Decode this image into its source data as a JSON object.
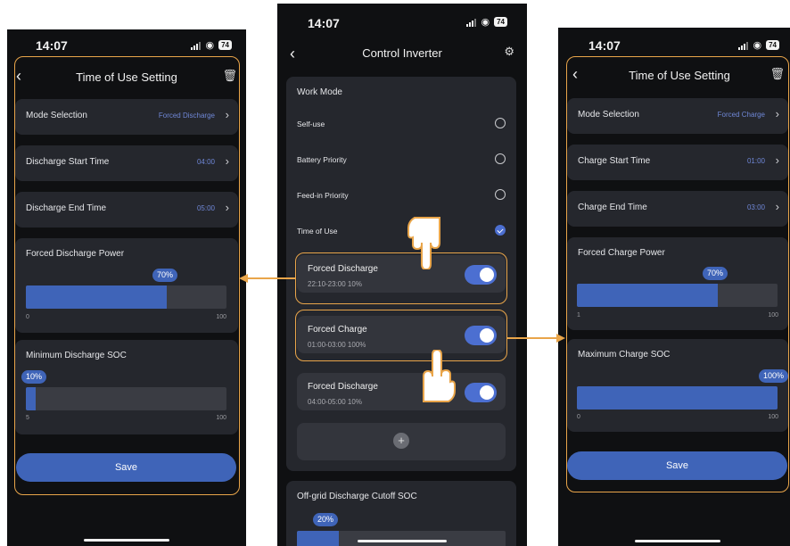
{
  "left_phone": {
    "status_time": "14:07",
    "battery": "74",
    "title": "Time of Use Setting",
    "rows": [
      {
        "label": "Mode Selection",
        "value": "Forced Discharge"
      },
      {
        "label": "Discharge Start Time",
        "value": "04:00"
      },
      {
        "label": "Discharge End Time",
        "value": "05:00"
      }
    ],
    "power": {
      "label": "Forced Discharge Power",
      "bubble": "70%",
      "value": 0.7,
      "min": "0",
      "max": "100"
    },
    "soc": {
      "label": "Minimum Discharge SOC",
      "bubble": "10%",
      "value": 0.05,
      "min": "5",
      "max": "100"
    },
    "save_label": "Save"
  },
  "center_phone": {
    "status_time": "14:07",
    "battery": "74",
    "title": "Control Inverter",
    "work_mode_title": "Work Mode",
    "modes": [
      {
        "label": "Self-use",
        "selected": false
      },
      {
        "label": "Battery Priority",
        "selected": false
      },
      {
        "label": "Feed-in Priority",
        "selected": false
      },
      {
        "label": "Time of Use",
        "selected": true
      }
    ],
    "schedules": [
      {
        "title": "Forced Discharge",
        "sub": "22:10-23:00  10%",
        "on": true
      },
      {
        "title": "Forced Charge",
        "sub": "01:00-03:00  100%",
        "on": true
      },
      {
        "title": "Forced Discharge",
        "sub": "04:00-05:00  10%",
        "on": true
      }
    ],
    "offgrid": {
      "label": "Off-grid Discharge Cutoff SOC",
      "bubble": "20%",
      "value": 0.2
    }
  },
  "right_phone": {
    "status_time": "14:07",
    "battery": "74",
    "title": "Time of Use Setting",
    "rows": [
      {
        "label": "Mode Selection",
        "value": "Forced Charge"
      },
      {
        "label": "Charge Start Time",
        "value": "01:00"
      },
      {
        "label": "Charge End Time",
        "value": "03:00"
      }
    ],
    "power": {
      "label": "Forced Charge Power",
      "bubble": "70%",
      "value": 0.7,
      "min": "1",
      "max": "100"
    },
    "soc": {
      "label": "Maximum Charge SOC",
      "bubble": "100%",
      "value": 1.0,
      "min": "0",
      "max": "100"
    },
    "save_label": "Save"
  },
  "colors": {
    "accent": "#3f64b8",
    "highlight": "#e9a54a",
    "card": "#25272d",
    "bg": "#0f1012"
  },
  "icons": [
    "back-chevron-icon",
    "trash-icon",
    "settings-icon",
    "signal-icon",
    "wifi-icon",
    "battery-icon",
    "chevron-right-icon",
    "plus-icon",
    "pointing-hand-icon",
    "arrow-icon"
  ]
}
